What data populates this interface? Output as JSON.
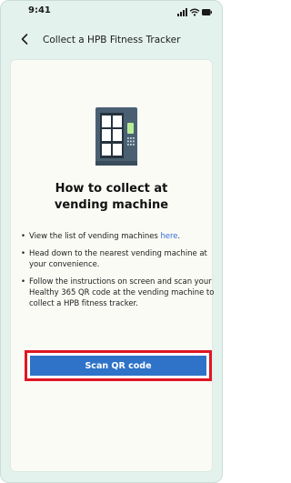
{
  "status_bar": {
    "time": "9:41",
    "icons": [
      "signal-icon",
      "wifi-icon",
      "battery-icon"
    ]
  },
  "nav": {
    "back_icon": "chevron-left-icon",
    "title": "Collect a HPB Fitness Tracker"
  },
  "card": {
    "illustration": "vending-machine-icon",
    "heading_line1": "How to collect at",
    "heading_line2": "vending machine",
    "instructions": [
      {
        "bullet": "•",
        "text_before_link": "View the list of vending machines ",
        "link_text": "here",
        "text_after_link": "."
      },
      {
        "bullet": "•",
        "text": "Head down to the nearest vending machine at your convenience."
      },
      {
        "bullet": "•",
        "text": "Follow the instructions on screen and scan your Healthy 365 QR code at the vending machine to collect a HPB fitness tracker."
      }
    ],
    "scan_button_label": "Scan QR code"
  },
  "colors": {
    "background": "#e4f2ed",
    "card": "#fbfbf6",
    "primary_button": "#2e73c8",
    "highlight_border": "#e01622",
    "link": "#2f6fd6",
    "machine_body": "#4a6072"
  }
}
